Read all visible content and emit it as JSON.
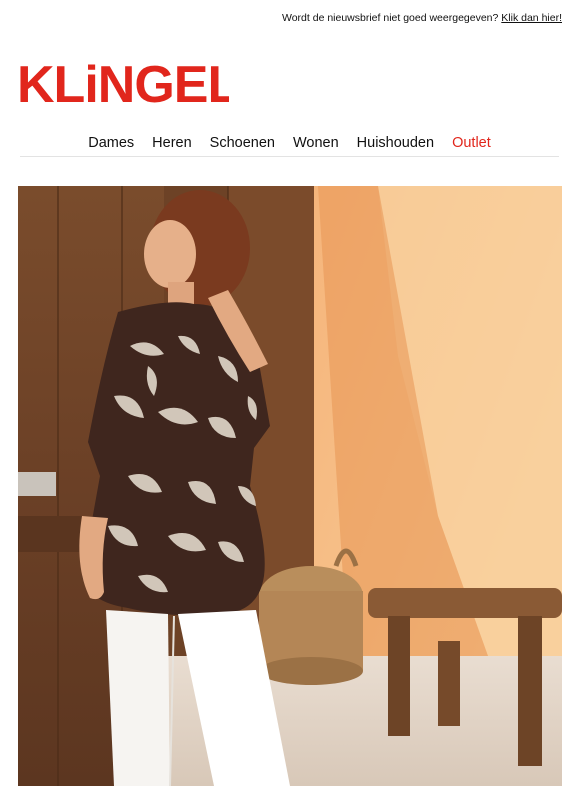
{
  "topbar": {
    "text": "Wordt de nieuwsbrief niet goed weergegeven?",
    "link": "Klik dan hier!"
  },
  "brand": {
    "logo_text": "KLiNGEL",
    "color": "#e1261c"
  },
  "nav": {
    "items": [
      {
        "label": "Dames"
      },
      {
        "label": "Heren"
      },
      {
        "label": "Schoenen"
      },
      {
        "label": "Wonen"
      },
      {
        "label": "Huishouden"
      },
      {
        "label": "Outlet",
        "accent": "#e1261c"
      }
    ]
  },
  "hero": {
    "subject": "Vrouw in bruine bloemenprint tuniek en witte broek voor een houten deur en oranje muur"
  }
}
